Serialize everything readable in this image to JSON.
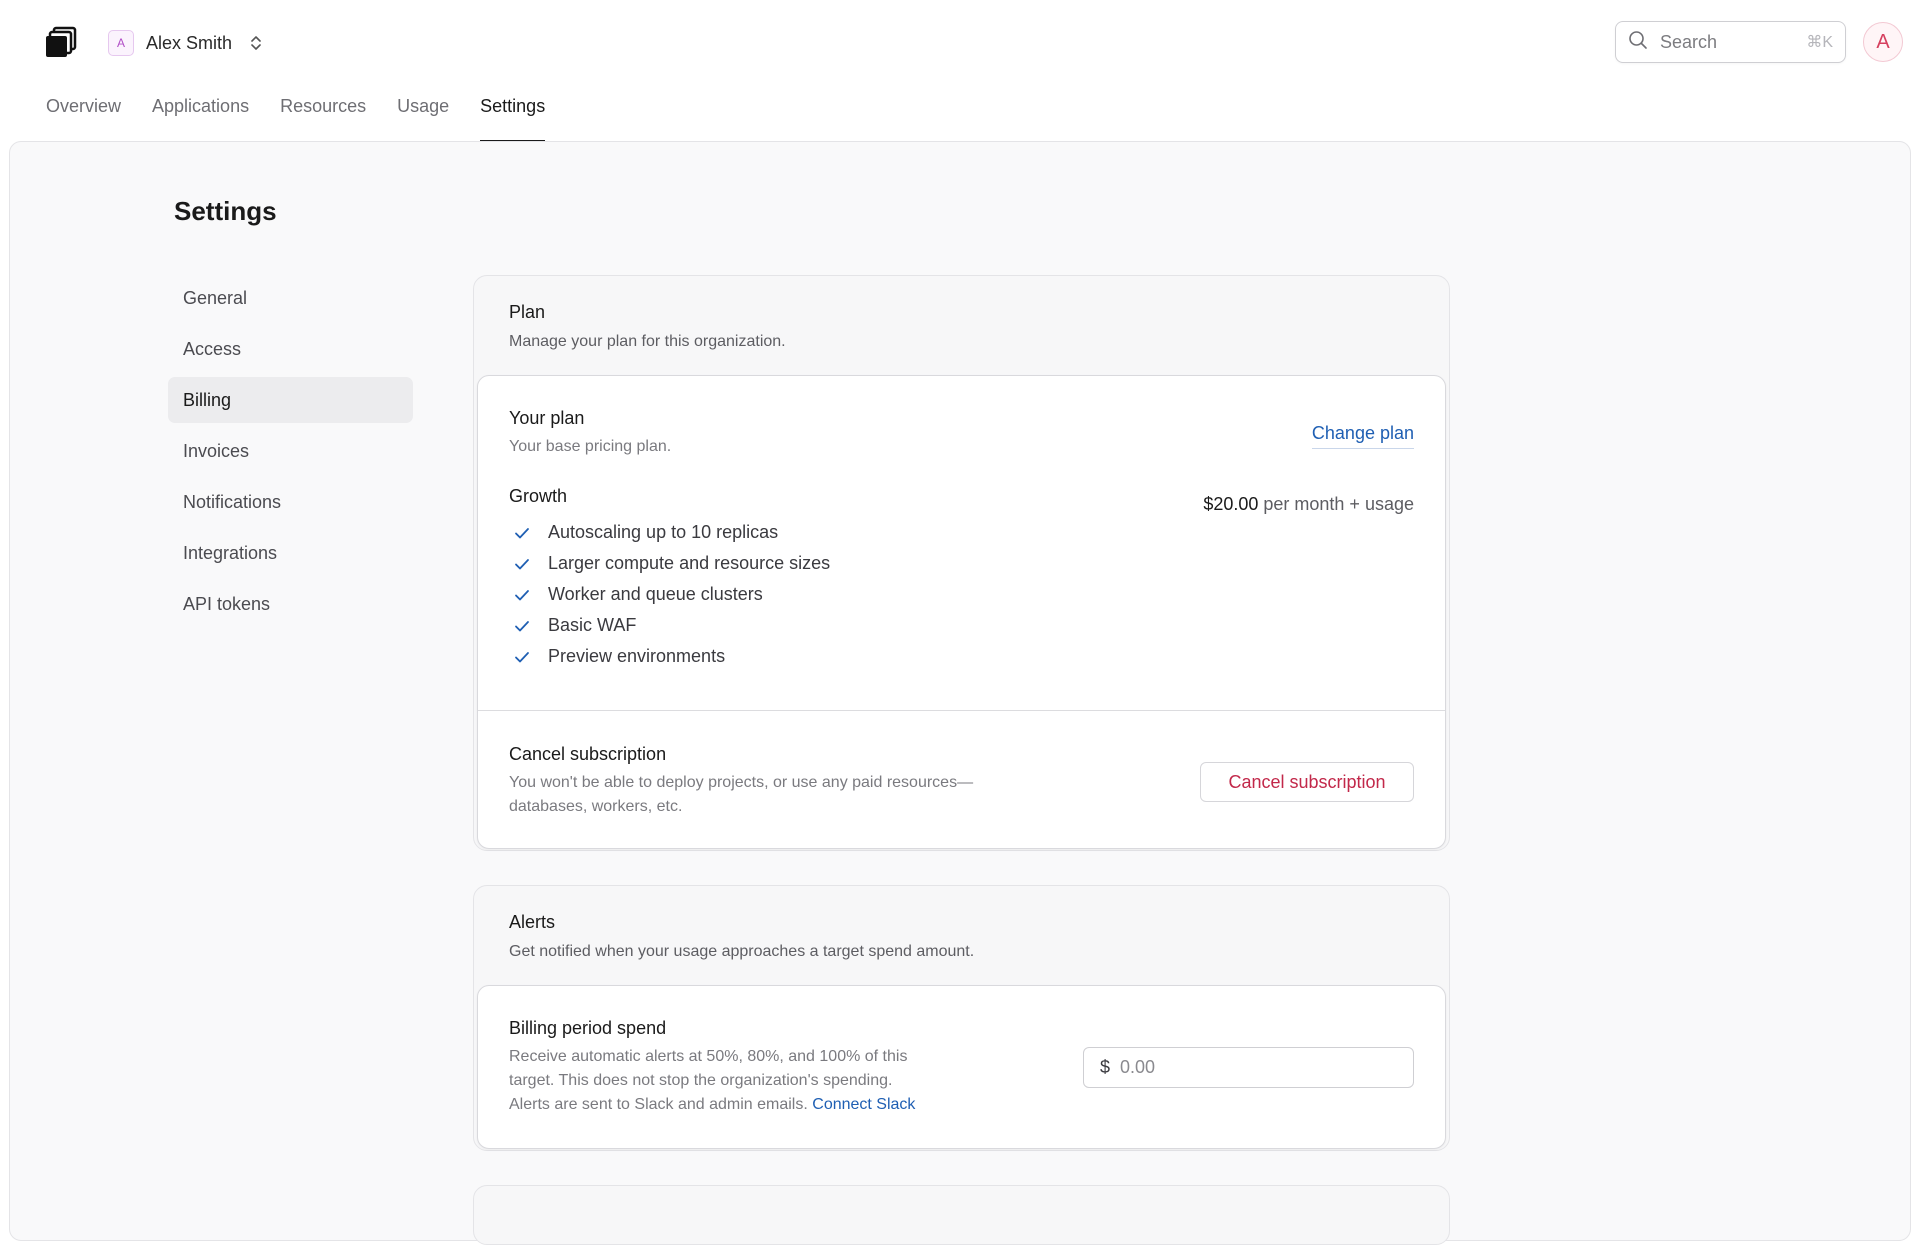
{
  "org": {
    "initial": "A",
    "name": "Alex Smith"
  },
  "search": {
    "placeholder": "Search",
    "shortcut": "⌘K"
  },
  "user": {
    "avatar_initial": "A"
  },
  "tabs": [
    {
      "label": "Overview",
      "active": false
    },
    {
      "label": "Applications",
      "active": false
    },
    {
      "label": "Resources",
      "active": false
    },
    {
      "label": "Usage",
      "active": false
    },
    {
      "label": "Settings",
      "active": true
    }
  ],
  "page": {
    "title": "Settings"
  },
  "sidebar": {
    "items": [
      {
        "label": "General"
      },
      {
        "label": "Access"
      },
      {
        "label": "Billing",
        "active": true
      },
      {
        "label": "Invoices"
      },
      {
        "label": "Notifications"
      },
      {
        "label": "Integrations"
      },
      {
        "label": "API tokens"
      }
    ]
  },
  "plan_card": {
    "title": "Plan",
    "description": "Manage your plan for this organization.",
    "your_plan": {
      "title": "Your plan",
      "description": "Your base pricing plan.",
      "change_label": "Change plan",
      "plan_name": "Growth",
      "price": "$20.00",
      "price_suffix": " per month + usage",
      "features": [
        "Autoscaling up to 10 replicas",
        "Larger compute and resource sizes",
        "Worker and queue clusters",
        "Basic WAF",
        "Preview environments"
      ]
    },
    "cancel": {
      "title": "Cancel subscription",
      "description_line1": "You won't be able to deploy projects, or use any paid resources—",
      "description_line2": "databases, workers, etc.",
      "button_label": "Cancel subscription"
    }
  },
  "alerts_card": {
    "title": "Alerts",
    "description": "Get notified when your usage approaches a target spend amount.",
    "billing_spend": {
      "title": "Billing period spend",
      "description_line1": "Receive automatic alerts at 50%, 80%, and 100% of this",
      "description_line2": "target. This does not stop the organization's spending.",
      "description_line3": "Alerts are sent to Slack and admin emails.",
      "link_label": "Connect Slack",
      "currency": "$",
      "input_placeholder": "0.00",
      "input_value": ""
    }
  },
  "colors": {
    "link": "#1f5fb3",
    "danger": "#c2284a",
    "check": "#1f5fb3",
    "panel_bg": "#f9f9fa"
  }
}
